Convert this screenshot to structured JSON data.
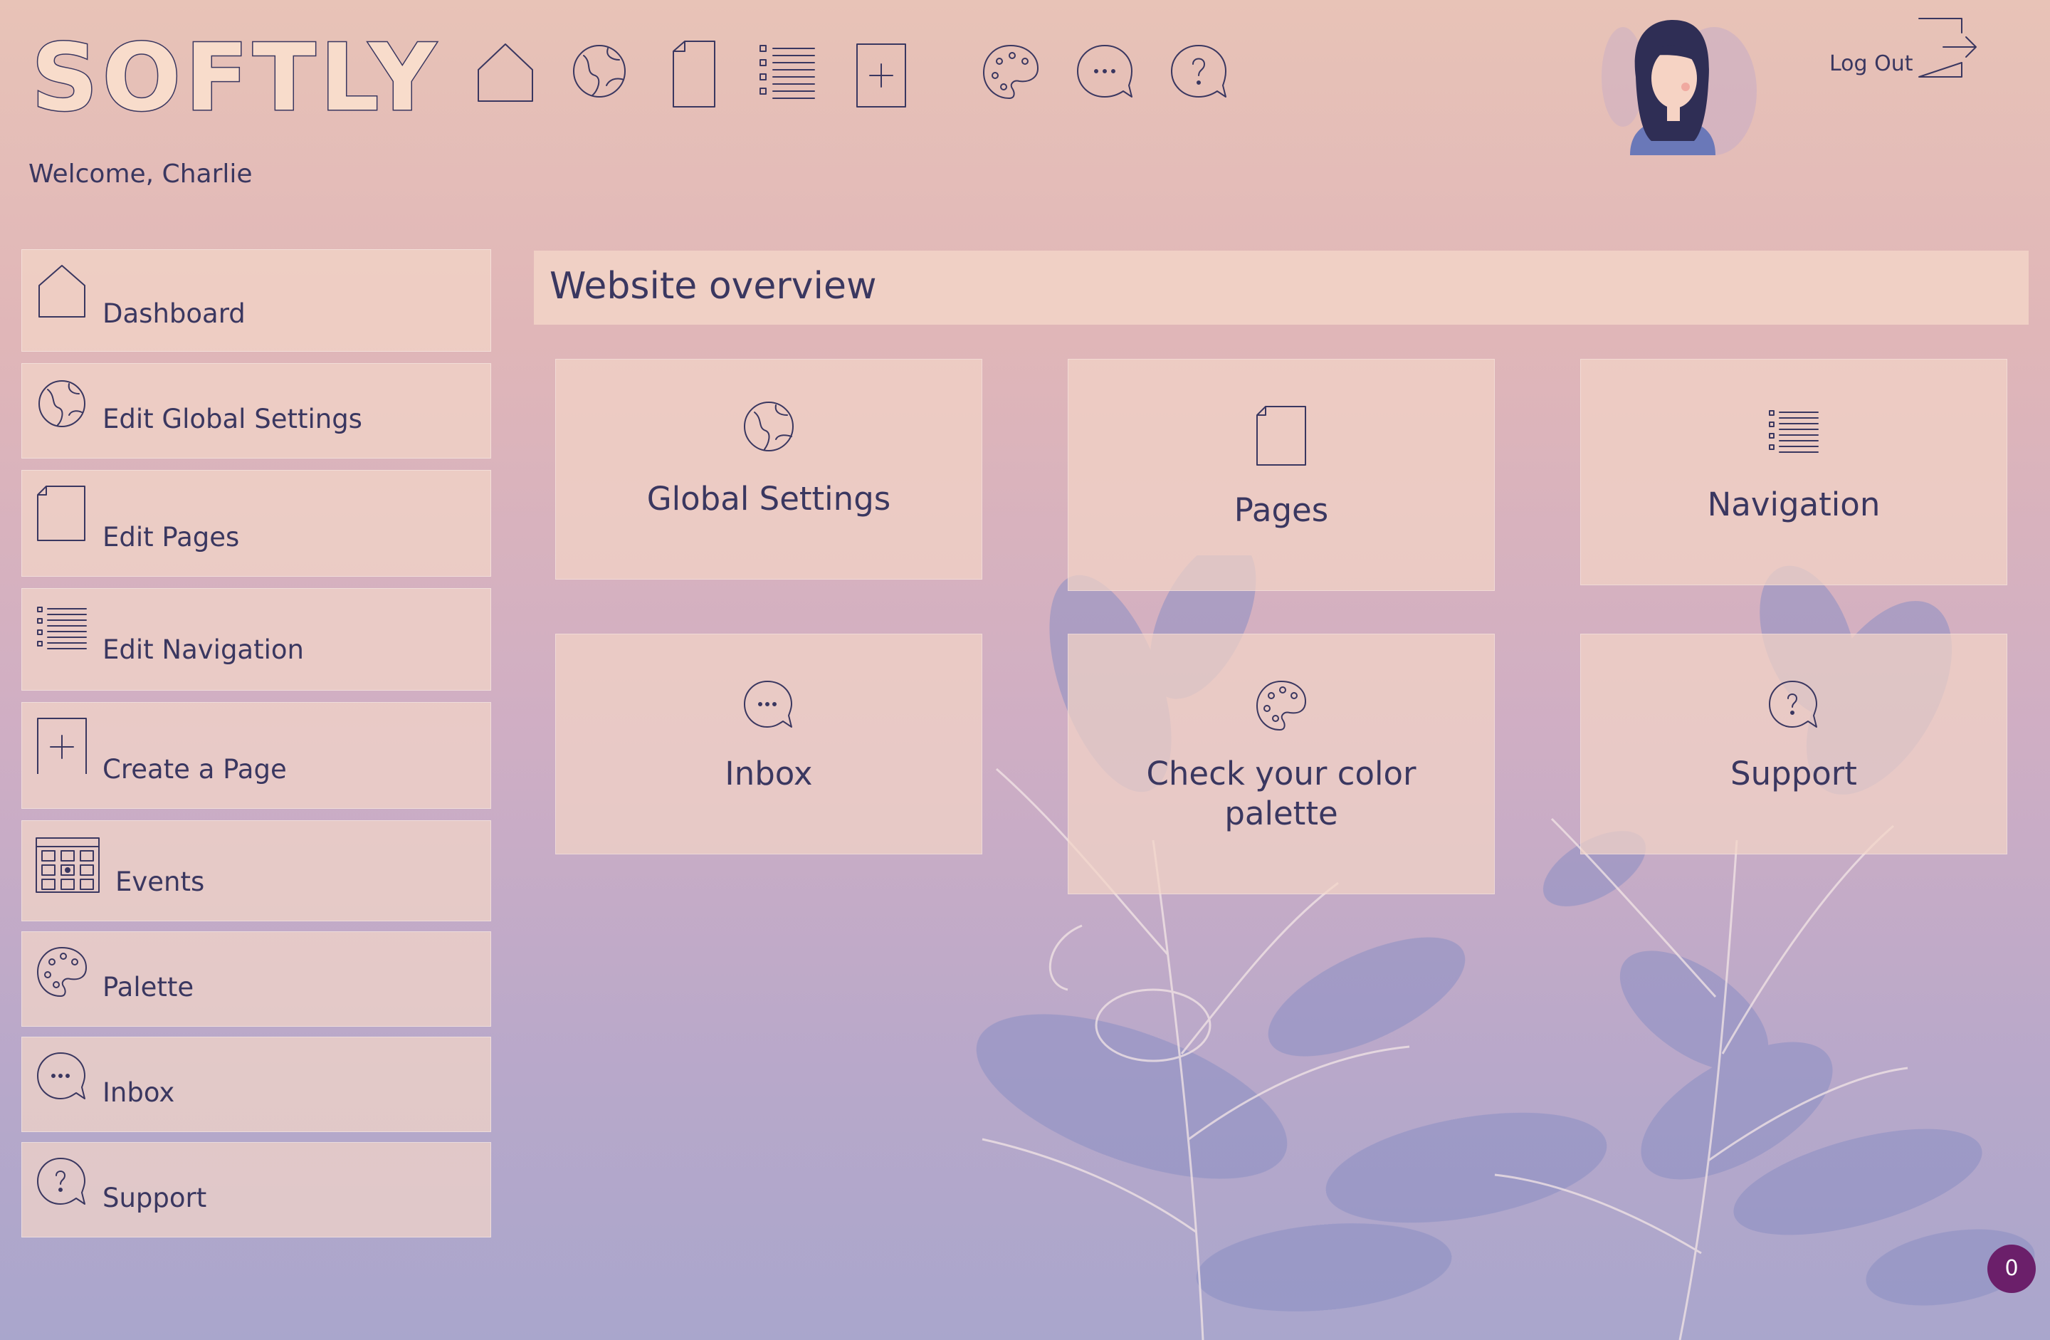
{
  "app": {
    "logo_text": "SOFTLY"
  },
  "header": {
    "welcome": "Welcome, Charlie",
    "logout_label": "Log Out",
    "top_icons": [
      "home-icon",
      "globe-icon",
      "page-icon",
      "list-icon",
      "plus-icon",
      "palette-icon",
      "chat-icon",
      "help-icon"
    ]
  },
  "sidebar": {
    "items": [
      {
        "label": "Dashboard",
        "icon": "home-icon"
      },
      {
        "label": "Edit Global Settings",
        "icon": "globe-icon"
      },
      {
        "label": "Edit Pages",
        "icon": "page-icon"
      },
      {
        "label": "Edit Navigation",
        "icon": "list-icon"
      },
      {
        "label": "Create a Page",
        "icon": "plus-icon"
      },
      {
        "label": "Events",
        "icon": "calendar-icon"
      },
      {
        "label": "Palette",
        "icon": "palette-icon"
      },
      {
        "label": "Inbox",
        "icon": "chat-icon"
      },
      {
        "label": "Support",
        "icon": "help-icon"
      }
    ]
  },
  "main": {
    "title": "Website overview",
    "cards": [
      {
        "label": "Global Settings",
        "icon": "globe-icon"
      },
      {
        "label": "Pages",
        "icon": "page-icon"
      },
      {
        "label": "Navigation",
        "icon": "list-icon"
      },
      {
        "label": "Inbox",
        "icon": "chat-icon"
      },
      {
        "label": "Check your color palette",
        "icon": "palette-icon"
      },
      {
        "label": "Support",
        "icon": "help-icon"
      }
    ]
  },
  "badge": {
    "count": "0"
  },
  "colors": {
    "text": "#3a3760",
    "panel": "#f3d6c8",
    "badge": "#6b1f6a",
    "accent_plant": "#8a8fc4"
  }
}
